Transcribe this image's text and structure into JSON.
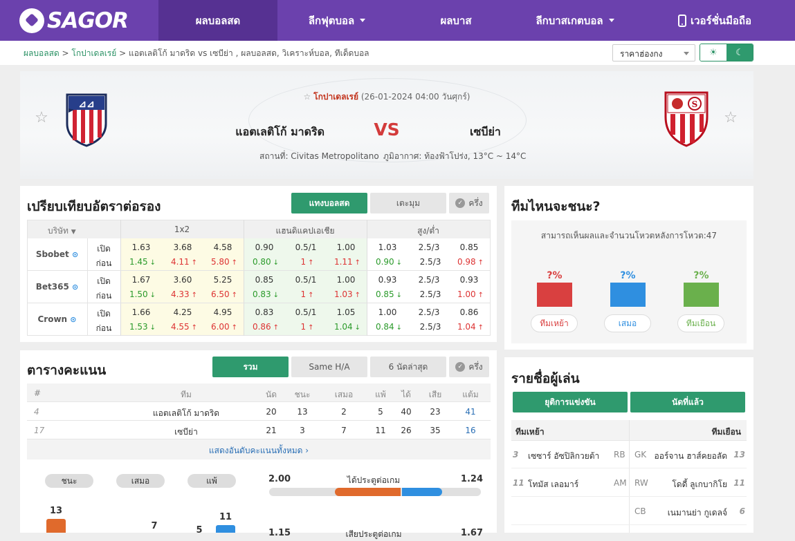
{
  "nav": {
    "logo": "SAGOR",
    "items": [
      "ผลบอลสด",
      "ลีกฟุตบอล",
      "ผลบาส",
      "ลีกบาสเกตบอล",
      "เวอร์ชั่นมือถือ"
    ]
  },
  "breadcrumb": {
    "home": "ผลบอลสด",
    "league": "โกปาเดลเรย์",
    "rest": "แอตเลติโก้ มาดริด vs  เซบีย่า ,  ผลบอลสด,  วิเคราะห์บอล,  ทีเด็ดบอล"
  },
  "odds_select": "ราคาฮ่องกง",
  "match": {
    "league": "โกปาเดลเรย์",
    "datetime": "(26-01-2024 04:00 วันศุกร์)",
    "home": "แอตเลติโก้ มาดริด",
    "away": "เซบีย่า",
    "vs": "VS",
    "venue": "สถานที่: Civitas Metropolitano",
    "weather": "ภูมิอากาศ: ท้องฟ้าโปร่ง, 13°C ~ 14°C"
  },
  "odds_section": {
    "title": "เปรียบเทียบอัตราต่อรอง",
    "tab_main": "แทงบอลสด",
    "tab_corner": "เตะมุม",
    "half": "ครึ่ง",
    "h_company": "บริษัท",
    "h_1x2": "1x2",
    "h_ah": "แฮนดิแคปเอเชีย",
    "h_ou": "สูง/ต่ำ",
    "open": "เปิด",
    "before": "ก่อน",
    "rows": [
      {
        "name": "Sbobet",
        "open": [
          "1.63",
          "3.68",
          "4.58",
          "0.90",
          "0.5/1",
          "1.00",
          "1.03",
          "2.5/3",
          "0.85"
        ],
        "prev": [
          "1.45",
          "4.11",
          "5.80",
          "0.80",
          "1",
          "1.11",
          "0.90",
          "2.5/3",
          "0.98"
        ],
        "dir": [
          "d",
          "u",
          "u",
          "d",
          "u",
          "u",
          "d",
          "",
          "u"
        ]
      },
      {
        "name": "Bet365",
        "open": [
          "1.67",
          "3.60",
          "5.25",
          "0.85",
          "0.5/1",
          "1.00",
          "0.93",
          "2.5/3",
          "0.93"
        ],
        "prev": [
          "1.50",
          "4.33",
          "6.50",
          "0.83",
          "1",
          "1.03",
          "0.85",
          "2.5/3",
          "1.00"
        ],
        "dir": [
          "d",
          "u",
          "u",
          "d",
          "u",
          "u",
          "d",
          "",
          "u"
        ]
      },
      {
        "name": "Crown",
        "open": [
          "1.66",
          "4.25",
          "4.95",
          "0.83",
          "0.5/1",
          "1.05",
          "1.00",
          "2.5/3",
          "0.86"
        ],
        "prev": [
          "1.53",
          "4.55",
          "6.00",
          "0.86",
          "1",
          "1.04",
          "0.84",
          "2.5/3",
          "1.04"
        ],
        "dir": [
          "d",
          "u",
          "u",
          "u",
          "u",
          "d",
          "d",
          "",
          "u"
        ]
      }
    ]
  },
  "standings": {
    "title": "ตารางคะแนน",
    "tab_all": "รวม",
    "tab_ha": "Same H/A",
    "tab_last": "6 นัดล่าสุด",
    "half": "ครึ่ง",
    "headers": [
      "#",
      "ทีม",
      "นัด",
      "ชนะ",
      "เสมอ",
      "แพ้",
      "ได้",
      "เสีย",
      "แต้ม"
    ],
    "rows": [
      [
        "4",
        "แอตเลติโก้ มาดริด",
        "20",
        "13",
        "2",
        "5",
        "40",
        "23",
        "41"
      ],
      [
        "17",
        "เซบีย่า",
        "21",
        "3",
        "7",
        "11",
        "26",
        "35",
        "16"
      ]
    ],
    "show_all": "แสดงอันดับคะแนนทั้งหมด"
  },
  "stats": {
    "win": "ชนะ",
    "draw": "เสมอ",
    "lose": "แพ้",
    "home_w": "13",
    "home_d": "7",
    "home_l": "5",
    "away_l": "11",
    "gf_label": "ได้ประตูต่อเกม",
    "gf_home": "2.00",
    "gf_away": "1.24",
    "ga_label": "เสียประตูต่อเกม",
    "ga_home": "1.15",
    "ga_away": "1.67",
    "gf_home_frac": 0.62,
    "gf_away_frac": 0.38
  },
  "vote": {
    "title": "ทีมไหนจะชนะ?",
    "desc": "สามารถเห็นผลและจำนวนโหวตหลังการโหวต:47",
    "pct": "?%",
    "home": "ทีมเหย้า",
    "draw": "เสมอ",
    "away": "ทีมเยือน",
    "colors": [
      "#d94040",
      "#2f8fe0",
      "#6ab04c"
    ]
  },
  "lineup": {
    "title": "รายชื่อผู้เล่น",
    "tab1": "ยุติการแข่งขัน",
    "tab2": "นัดที่แล้ว",
    "home": "ทีมเหย้า",
    "away": "ทีมเยือน",
    "rows": [
      {
        "hn": "3",
        "hp": "เซซาร์ อัซปิลิกวยต้า",
        "hpos": "RB",
        "apos": "GK",
        "ap": "ออร์จาน ฮาส์คยอลัด",
        "an": "13"
      },
      {
        "hn": "11",
        "hp": "โทมัส เลอมาร์",
        "hpos": "AM",
        "apos": "RW",
        "ap": "โดดี้ ลูเกบากิโย",
        "an": "11"
      },
      {
        "hn": "",
        "hp": "",
        "hpos": "",
        "apos": "CB",
        "ap": "เนมานย่า กูเดลจ์",
        "an": "6"
      }
    ]
  }
}
